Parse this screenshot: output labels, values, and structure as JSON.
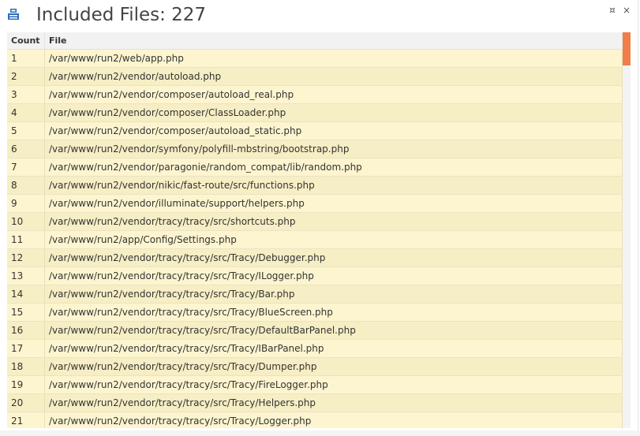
{
  "title": {
    "label": "Included Files: 227"
  },
  "controls": {
    "pin_glyph": "¤",
    "close_glyph": "×"
  },
  "table": {
    "columns": [
      "Count",
      "File"
    ],
    "rows": [
      {
        "count": "1",
        "file": "/var/www/run2/web/app.php"
      },
      {
        "count": "2",
        "file": "/var/www/run2/vendor/autoload.php"
      },
      {
        "count": "3",
        "file": "/var/www/run2/vendor/composer/autoload_real.php"
      },
      {
        "count": "4",
        "file": "/var/www/run2/vendor/composer/ClassLoader.php"
      },
      {
        "count": "5",
        "file": "/var/www/run2/vendor/composer/autoload_static.php"
      },
      {
        "count": "6",
        "file": "/var/www/run2/vendor/symfony/polyfill-mbstring/bootstrap.php"
      },
      {
        "count": "7",
        "file": "/var/www/run2/vendor/paragonie/random_compat/lib/random.php"
      },
      {
        "count": "8",
        "file": "/var/www/run2/vendor/nikic/fast-route/src/functions.php"
      },
      {
        "count": "9",
        "file": "/var/www/run2/vendor/illuminate/support/helpers.php"
      },
      {
        "count": "10",
        "file": "/var/www/run2/vendor/tracy/tracy/src/shortcuts.php"
      },
      {
        "count": "11",
        "file": "/var/www/run2/app/Config/Settings.php"
      },
      {
        "count": "12",
        "file": "/var/www/run2/vendor/tracy/tracy/src/Tracy/Debugger.php"
      },
      {
        "count": "13",
        "file": "/var/www/run2/vendor/tracy/tracy/src/Tracy/ILogger.php"
      },
      {
        "count": "14",
        "file": "/var/www/run2/vendor/tracy/tracy/src/Tracy/Bar.php"
      },
      {
        "count": "15",
        "file": "/var/www/run2/vendor/tracy/tracy/src/Tracy/BlueScreen.php"
      },
      {
        "count": "16",
        "file": "/var/www/run2/vendor/tracy/tracy/src/Tracy/DefaultBarPanel.php"
      },
      {
        "count": "17",
        "file": "/var/www/run2/vendor/tracy/tracy/src/Tracy/IBarPanel.php"
      },
      {
        "count": "18",
        "file": "/var/www/run2/vendor/tracy/tracy/src/Tracy/Dumper.php"
      },
      {
        "count": "19",
        "file": "/var/www/run2/vendor/tracy/tracy/src/Tracy/FireLogger.php"
      },
      {
        "count": "20",
        "file": "/var/www/run2/vendor/tracy/tracy/src/Tracy/Helpers.php"
      },
      {
        "count": "21",
        "file": "/var/www/run2/vendor/tracy/tracy/src/Tracy/Logger.php"
      }
    ]
  },
  "colors": {
    "row_odd": "#fdf5cf",
    "row_even": "#f6eec4",
    "scroll_thumb": "#f07d4a",
    "icon_blue": "#2a6fb8"
  },
  "scroll": {
    "position_fraction": 0.0
  }
}
